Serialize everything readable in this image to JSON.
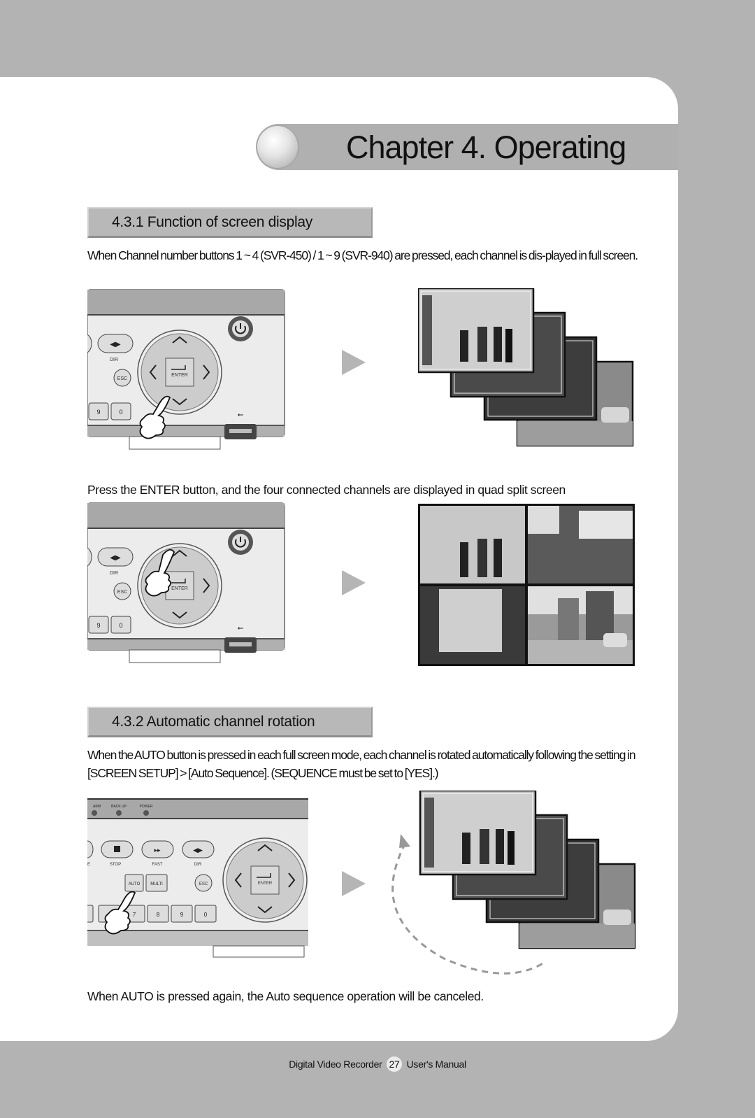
{
  "chapter": {
    "title": "Chapter 4. Operating"
  },
  "sections": [
    {
      "heading": "4.3.1 Function of screen display",
      "paragraph": "When Channel number buttons 1 ~ 4 (SVR-450) / 1 ~ 9 (SVR-940) are pressed, each channel is dis-played in full screen.",
      "paragraph2": "Press the ENTER button, and the four connected channels are displayed in quad split  screen"
    },
    {
      "heading": "4.3.2 Automatic channel rotation",
      "paragraph": "When the AUTO button is pressed in each full screen mode, each channel is rotated automatically following the setting in [SCREEN SETUP] > [Auto Sequence]. (SEQUENCE must be set to [YES].)",
      "paragraph2": "When AUTO is pressed again, the Auto sequence operation will be canceled."
    }
  ],
  "device_labels": {
    "dir": "DIR",
    "esc": "ESC",
    "enter": "ENTER",
    "nine": "9",
    "zero": "0",
    "eight": "8",
    "seven": "7",
    "stop": "STOP",
    "fast": "FAST",
    "auto": "AUTO",
    "multi": "MULTI",
    "alarm": "ARM",
    "backup": "BACK UP",
    "power": "POWER",
    "e_label": "E"
  },
  "footer": {
    "left": "Digital Video Recorder",
    "page": "27",
    "right": "User's Manual"
  }
}
